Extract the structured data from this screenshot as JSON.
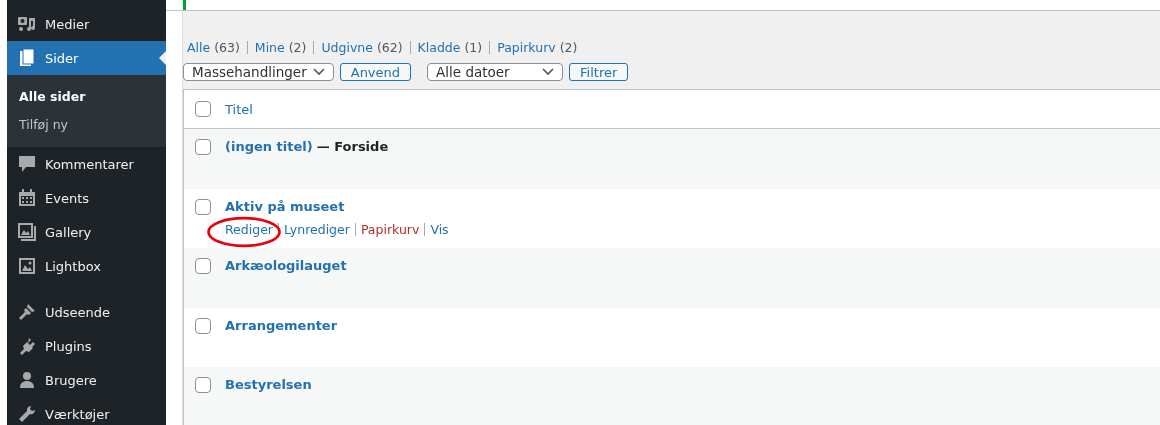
{
  "sidebar": {
    "groups": [
      [
        {
          "label": "Medier",
          "selected": false
        },
        {
          "label": "Sider",
          "selected": true,
          "children": [
            {
              "label": "Alle sider",
              "selected": true
            },
            {
              "label": "Tilføj ny",
              "selected": false
            }
          ]
        },
        {
          "label": "Kommentarer",
          "selected": false
        },
        {
          "label": "Events",
          "selected": false
        },
        {
          "label": "Gallery",
          "selected": false
        },
        {
          "label": "Lightbox",
          "selected": false
        }
      ],
      [
        {
          "label": "Udseende",
          "selected": false
        },
        {
          "label": "Plugins",
          "selected": false
        },
        {
          "label": "Brugere",
          "selected": false
        },
        {
          "label": "Værktøjer",
          "selected": false
        }
      ]
    ]
  },
  "status_links": [
    {
      "label": "Alle",
      "count": "(63)"
    },
    {
      "label": "Mine",
      "count": "(2)"
    },
    {
      "label": "Udgivne",
      "count": "(62)"
    },
    {
      "label": "Kladde",
      "count": "(1)"
    },
    {
      "label": "Papirkurv",
      "count": "(2)"
    }
  ],
  "toolbar": {
    "bulk_select": {
      "value": "Massehandlinger"
    },
    "apply_button": "Anvend",
    "date_select": {
      "value": "Alle datoer"
    },
    "filter_button": "Filtrer"
  },
  "table": {
    "header": {
      "checked": false,
      "title": "Titel"
    },
    "rows": [
      {
        "checked": false,
        "title": "(ingen titel)",
        "state": "— Forside"
      },
      {
        "checked": false,
        "title": "Aktiv på museet",
        "actions": [
          {
            "label": "Rediger",
            "kind": "link"
          },
          {
            "label": "Lynrediger",
            "kind": "link"
          },
          {
            "label": "Papirkurv",
            "kind": "delete"
          },
          {
            "label": "Vis",
            "kind": "link"
          }
        ],
        "annotation": {
          "kind": "ellipse",
          "color": "#e8000b"
        }
      },
      {
        "checked": false,
        "title": "Arkæologilauget"
      },
      {
        "checked": false,
        "title": "Arrangementer"
      },
      {
        "checked": false,
        "title": "Bestyrelsen"
      }
    ]
  }
}
